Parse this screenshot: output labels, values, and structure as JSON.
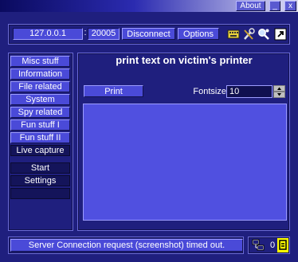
{
  "titlebar": {
    "about_label": "About",
    "minimize_label": "_",
    "close_label": "x"
  },
  "connection": {
    "ip": "127.0.0.1",
    "separator": ":",
    "port": "20005",
    "disconnect_label": "Disconnect",
    "options_label": "Options"
  },
  "toolbar_icons": [
    "keyboard-icon",
    "tools-icon",
    "search-user-icon",
    "shortcut-icon"
  ],
  "sidebar": {
    "categories": [
      {
        "label": "Misc stuff"
      },
      {
        "label": "Information"
      },
      {
        "label": "File related"
      },
      {
        "label": "System"
      },
      {
        "label": "Spy related"
      },
      {
        "label": "Fun stuff I"
      },
      {
        "label": "Fun stuff II"
      },
      {
        "label": "Live capture"
      }
    ],
    "actions": [
      {
        "label": "Start"
      },
      {
        "label": "Settings"
      },
      {
        "label": ""
      }
    ]
  },
  "main": {
    "title": "print text on victim's printer",
    "print_label": "Print",
    "fontsize_label": "Fontsize",
    "fontsize_value": "10",
    "text_area_value": ""
  },
  "status": {
    "message": "Server Connection request (screenshot) timed out.",
    "count": "0"
  },
  "colors": {
    "background": "#1f1f7e",
    "button": "#4a4ad8",
    "highlight": "#ffff00"
  }
}
